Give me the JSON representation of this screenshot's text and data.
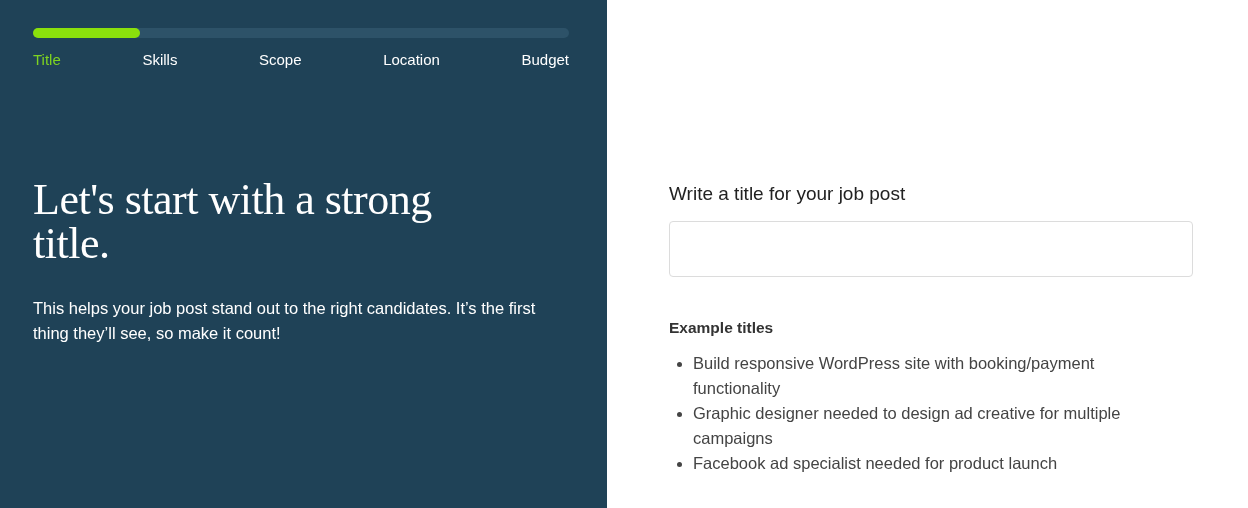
{
  "progress": {
    "level": 0.2
  },
  "steps": [
    {
      "label": "Title",
      "selected": true
    },
    {
      "label": "Skills",
      "selected": false
    },
    {
      "label": "Scope",
      "selected": false
    },
    {
      "label": "Location",
      "selected": false
    },
    {
      "label": "Budget",
      "selected": false
    }
  ],
  "heading": "Let's start with a strong title.",
  "description": "This helps your job post stand out to the right candidates. It’s the first thing they’ll see, so make it count!",
  "title_field": {
    "label": "Write a title for your job post"
  },
  "examples": {
    "heading": "Example titles",
    "items": [
      "Build responsive WordPress site with booking/payment functionality",
      "Graphic designer needed to design ad creative for multiple campaigns",
      "Facebook ad specialist needed for product launch"
    ]
  }
}
